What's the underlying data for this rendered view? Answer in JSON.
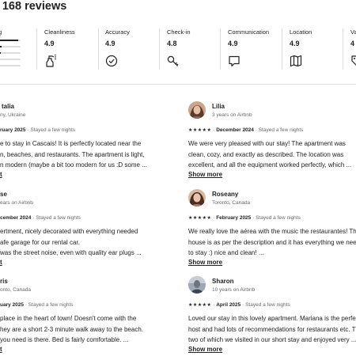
{
  "header": {
    "title": "· 168 reviews"
  },
  "overall_label": "g",
  "rating_distribution": [
    0.9,
    0.06,
    0.02,
    0.01,
    0.01
  ],
  "categories": [
    {
      "label": "Cleanliness",
      "value": "4.9",
      "icon": "spray-bottle-icon"
    },
    {
      "label": "Accuracy",
      "value": "4.9",
      "icon": "check-circle-icon"
    },
    {
      "label": "Check-in",
      "value": "4.8",
      "icon": "key-icon"
    },
    {
      "label": "Communication",
      "value": "4.9",
      "icon": "chat-bubble-icon"
    },
    {
      "label": "Location",
      "value": "4.9",
      "icon": "map-icon"
    },
    {
      "label": "Va",
      "value": "4",
      "icon": "price-tag-icon"
    }
  ],
  "reviews_left": [
    {
      "name": "talia",
      "sub": "ny, Ukraine",
      "stars": "",
      "date": "ruary 2025",
      "stay": "Stayed a few nights",
      "lines": [
        "e to stay in Cascais! It is perfectly located near the",
        "n, beaches, and restaurants. The apartment is light,",
        "n modern (maybe a bit too modern for us :D some ..."
      ],
      "more": "t"
    },
    {
      "name": "se",
      "sub": "ears on Airbnb",
      "stars": "",
      "date": "cember 2024",
      "stay": "Stayed a few nights",
      "lines": [
        "ertment, nicely decorated with everything needed",
        "afe garage for our rental car.",
        "was the street noise, even with quality ear plugs ..."
      ],
      "more": "t"
    },
    {
      "name": "ris",
      "sub": "onto, Canada",
      "stars": "",
      "date": "uary 2025",
      "stay": "Stayed a few nights",
      "lines": [
        "place in the heart of town! Doesn't come with the",
        "hey are a short 2-3 minute walk away to the beach.",
        "you need is there.  Bed is fairly comfortable.  ..."
      ],
      "more": "t"
    }
  ],
  "reviews_right": [
    {
      "name": "Lilia",
      "sub": "3 years on Airbnb",
      "stars": "★★★★★",
      "date": "December 2024",
      "stay": "Stayed a few nights",
      "lines": [
        "We were very pleased with our stay! The apartment was",
        "clean, cozy, and exactly as described. The location was",
        "excellent, and all the equipment worked perfectly, which ..."
      ],
      "more": "Show more"
    },
    {
      "name": "Roseany",
      "sub": "Toronto, Canada",
      "stars": "★★★★★",
      "date": "February 2025",
      "stay": "Stayed a few nights",
      "lines": [
        "We really love the aérea with the music the restaurantes! The",
        "house is as per the description and it has everything we need",
        "to stay :) nice and clean! ..."
      ],
      "more": "Show more"
    },
    {
      "name": "Sharon",
      "sub": "10 years on Airbnb",
      "stars": "★★★★★",
      "date": "April 2025",
      "stay": "Stayed a few nights",
      "lines": [
        "Loved our stay in this lovely apartment. Mariana is the perfect",
        "host and had lots of recommendations for restaurants etc.  The",
        "two of which we visited in our short stay and enjoyed very ..."
      ],
      "more": "Show more"
    }
  ]
}
